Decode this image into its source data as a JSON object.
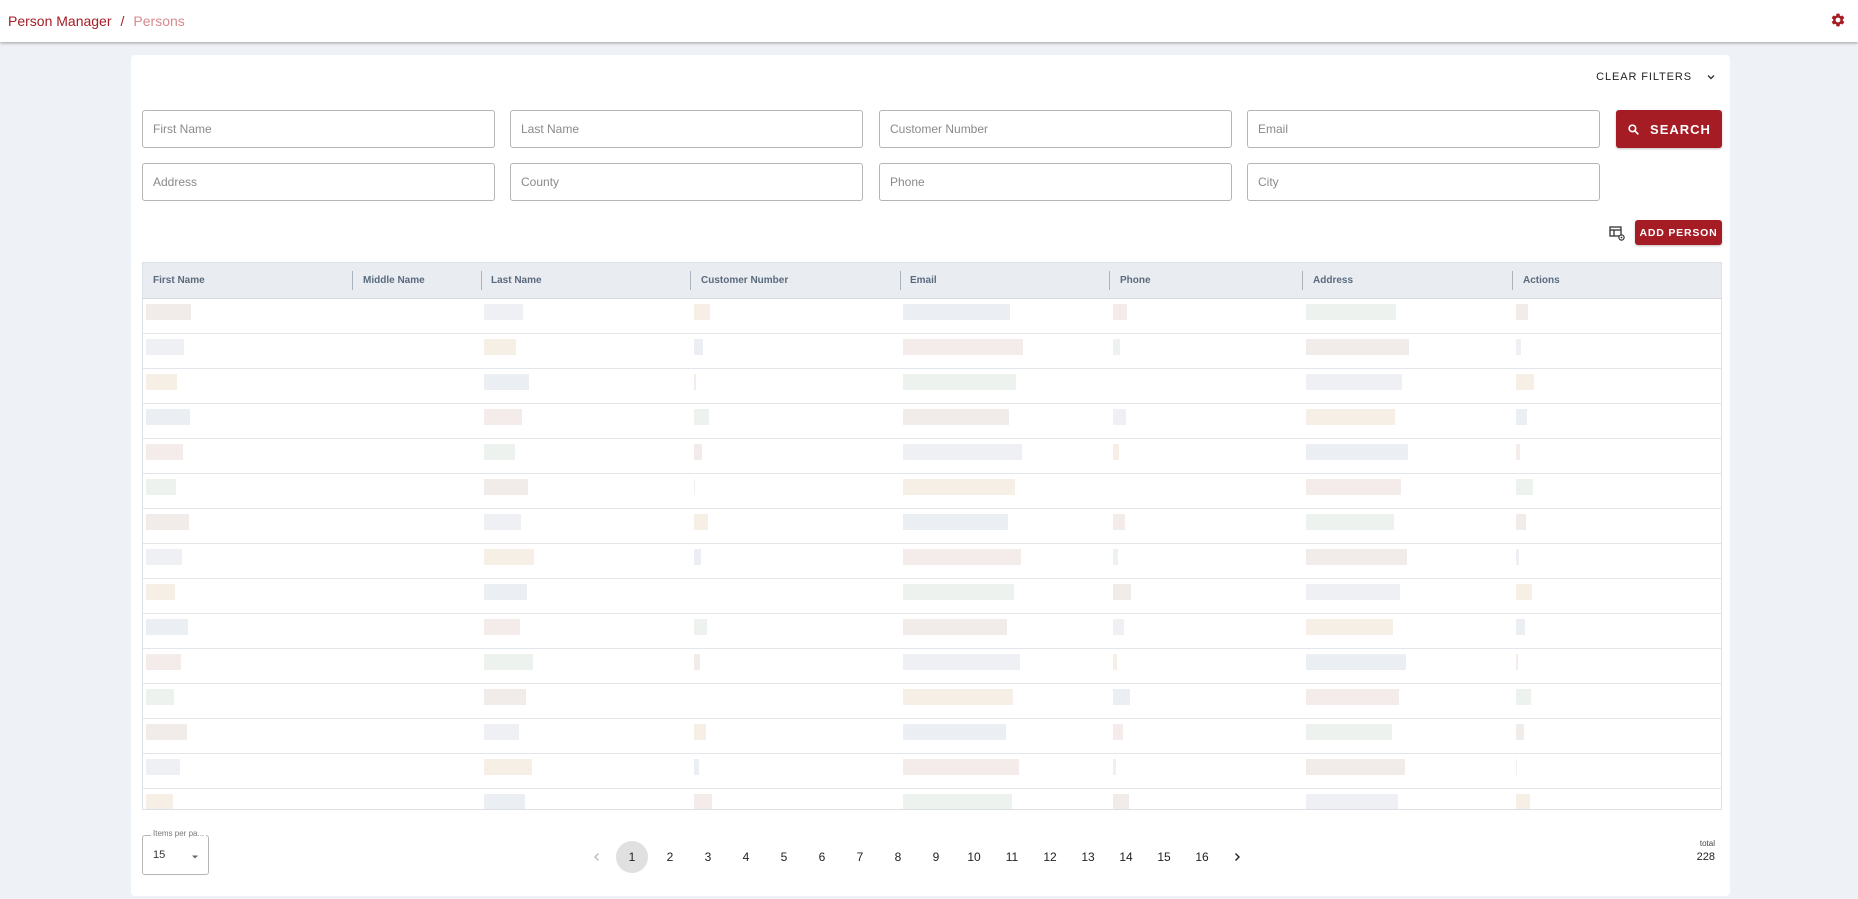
{
  "breadcrumb": {
    "app": "Person Manager",
    "separator": "/",
    "current": "Persons"
  },
  "icons": {
    "settings": "gear-icon",
    "search": "search-icon",
    "columns": "table-columns-icon"
  },
  "colors": {
    "brand": "#a51c24",
    "brand_light": "#d8898d",
    "background": "#eef1f5",
    "header_bg": "#e9ecf1"
  },
  "filters": {
    "clear_label": "CLEAR FILTERS",
    "first_name": {
      "placeholder": "First Name",
      "value": ""
    },
    "last_name": {
      "placeholder": "Last Name",
      "value": ""
    },
    "customer_number": {
      "placeholder": "Customer Number",
      "value": ""
    },
    "email": {
      "placeholder": "Email",
      "value": ""
    },
    "address": {
      "placeholder": "Address",
      "value": ""
    },
    "county": {
      "placeholder": "County",
      "value": ""
    },
    "phone": {
      "placeholder": "Phone",
      "value": ""
    },
    "city": {
      "placeholder": "City",
      "value": ""
    },
    "search_label": "SEARCH"
  },
  "toolbar": {
    "add_label": "ADD PERSON"
  },
  "table": {
    "columns": [
      "First Name",
      "Middle Name",
      "Last Name",
      "Customer Number",
      "Email",
      "Phone",
      "Address",
      "Actions"
    ],
    "rows_visible": 15
  },
  "pagination": {
    "items_per_page_label": "Items per pa...",
    "items_per_page": "15",
    "pages": [
      "1",
      "2",
      "3",
      "4",
      "5",
      "6",
      "7",
      "8",
      "9",
      "10",
      "11",
      "12",
      "13",
      "14",
      "15",
      "16"
    ],
    "current_page": "1",
    "total_label": "total",
    "total_value": "228"
  }
}
